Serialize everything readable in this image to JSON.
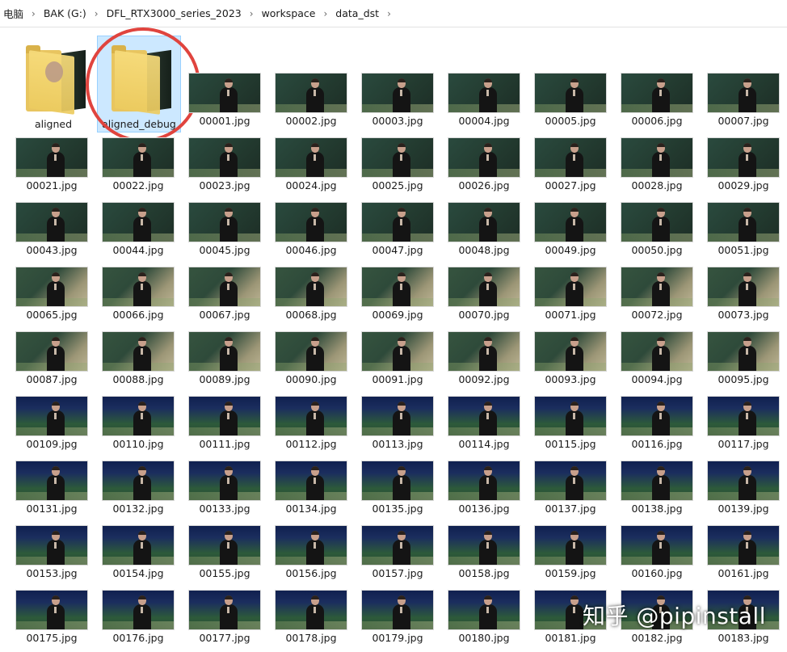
{
  "breadcrumb": {
    "items": [
      "电脑",
      "BAK (G:)",
      "DFL_RTX3000_series_2023",
      "workspace",
      "data_dst"
    ],
    "separator_icon": "chevron-right-icon"
  },
  "folders": [
    {
      "name": "aligned",
      "selected": false
    },
    {
      "name": "aligned_debug",
      "selected": true,
      "highlight": "red-circle"
    }
  ],
  "files": [
    "00001.jpg",
    "00002.jpg",
    "00003.jpg",
    "00004.jpg",
    "00005.jpg",
    "00006.jpg",
    "00007.jpg",
    "00021.jpg",
    "00022.jpg",
    "00023.jpg",
    "00024.jpg",
    "00025.jpg",
    "00026.jpg",
    "00027.jpg",
    "00028.jpg",
    "00029.jpg",
    "00043.jpg",
    "00044.jpg",
    "00045.jpg",
    "00046.jpg",
    "00047.jpg",
    "00048.jpg",
    "00049.jpg",
    "00050.jpg",
    "00051.jpg",
    "00065.jpg",
    "00066.jpg",
    "00067.jpg",
    "00068.jpg",
    "00069.jpg",
    "00070.jpg",
    "00071.jpg",
    "00072.jpg",
    "00073.jpg",
    "00087.jpg",
    "00088.jpg",
    "00089.jpg",
    "00090.jpg",
    "00091.jpg",
    "00092.jpg",
    "00093.jpg",
    "00094.jpg",
    "00095.jpg",
    "00109.jpg",
    "00110.jpg",
    "00111.jpg",
    "00112.jpg",
    "00113.jpg",
    "00114.jpg",
    "00115.jpg",
    "00116.jpg",
    "00117.jpg",
    "00131.jpg",
    "00132.jpg",
    "00133.jpg",
    "00134.jpg",
    "00135.jpg",
    "00136.jpg",
    "00137.jpg",
    "00138.jpg",
    "00139.jpg",
    "00153.jpg",
    "00154.jpg",
    "00155.jpg",
    "00156.jpg",
    "00157.jpg",
    "00158.jpg",
    "00159.jpg",
    "00160.jpg",
    "00161.jpg",
    "00175.jpg",
    "00176.jpg",
    "00177.jpg",
    "00178.jpg",
    "00179.jpg",
    "00180.jpg",
    "00181.jpg",
    "00182.jpg",
    "00183.jpg"
  ],
  "watermark": "知乎 @pipinstall",
  "colors": {
    "selection_fill": "#cce8ff",
    "selection_border": "#99d1ff",
    "highlight_circle": "#e0443e",
    "folder_yellow": "#f7dc7c"
  }
}
